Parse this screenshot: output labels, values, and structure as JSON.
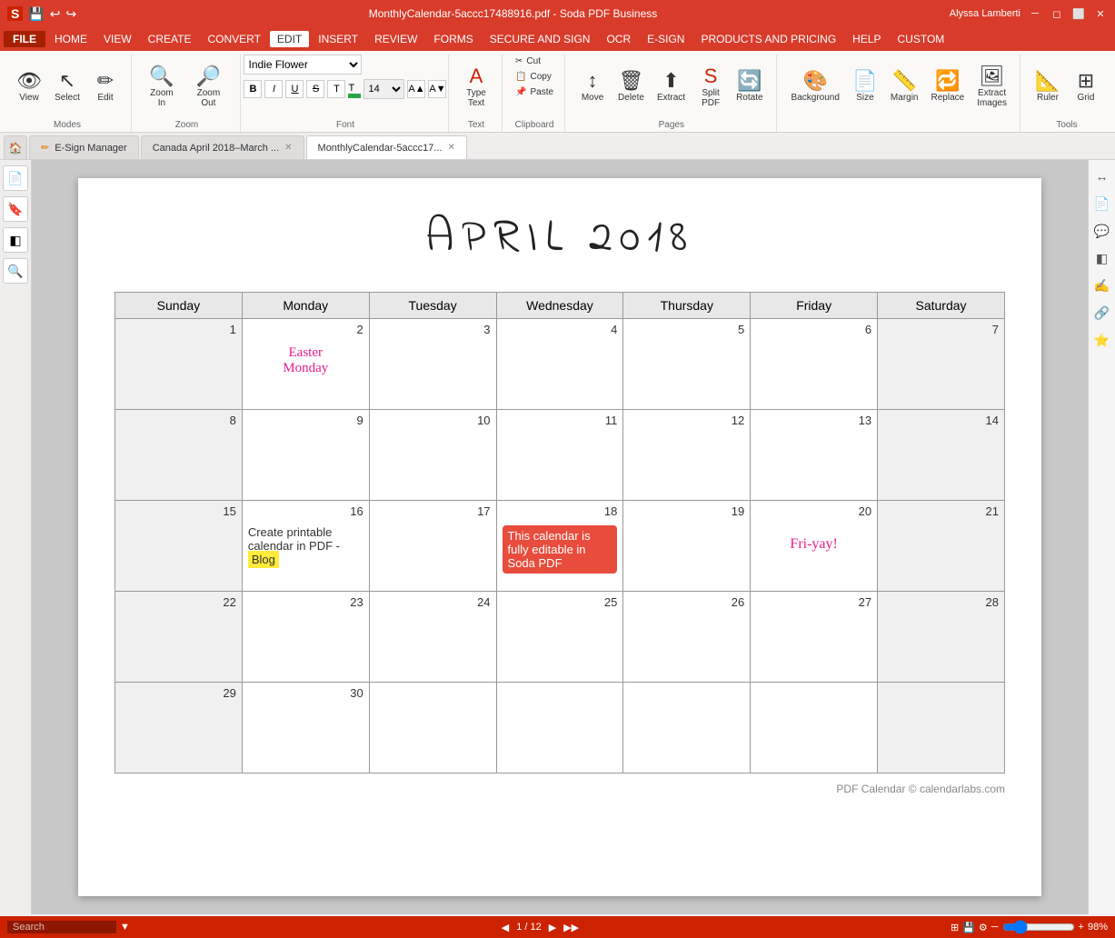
{
  "titlebar": {
    "document_name": "MonthlyCalendar-5accc17488916.pdf",
    "app_name": "Soda PDF Business",
    "full_title": "MonthlyCalendar-5accc17488916.pdf  -  Soda PDF Business"
  },
  "menubar": {
    "items": [
      "FILE",
      "HOME",
      "VIEW",
      "CREATE",
      "CONVERT",
      "EDIT",
      "INSERT",
      "REVIEW",
      "FORMS",
      "SECURE AND SIGN",
      "OCR",
      "E-SIGN",
      "PRODUCTS AND PRICING",
      "HELP",
      "CUSTOM"
    ],
    "active": "EDIT"
  },
  "ribbon": {
    "modes_group": {
      "label": "Modes",
      "view_label": "View",
      "select_label": "Select",
      "edit_label": "Edit"
    },
    "zoom_group": {
      "label": "Zoom",
      "zoom_in_label": "Zoom In",
      "zoom_out_label": "Zoom Out"
    },
    "font_group": {
      "label": "Font",
      "font_name": "Indie Flower",
      "font_size": "14",
      "bold": "B",
      "italic": "I",
      "underline": "U",
      "strikethrough": "S",
      "superscript": "T",
      "subscript": "T"
    },
    "text_group": {
      "label": "Text",
      "type_text_label": "Type\nText"
    },
    "clipboard_group": {
      "label": "Clipboard",
      "cut_label": "Cut",
      "copy_label": "Copy",
      "paste_label": "Paste"
    },
    "pages_group": {
      "label": "Pages",
      "move_label": "Move",
      "delete_label": "Delete",
      "extract_label": "Extract",
      "split_pdf_label": "Split\nPDF",
      "rotate_label": "Rotate"
    },
    "bg_group": {
      "label": "",
      "background_label": "Background",
      "size_label": "Size",
      "margin_label": "Margin",
      "replace_label": "Replace",
      "extract_images_label": "Extract\nImages"
    },
    "tools_group": {
      "label": "Tools",
      "ruler_label": "Ruler",
      "grid_label": "Grid"
    }
  },
  "tabs": {
    "items": [
      {
        "id": "esign",
        "label": "E-Sign Manager",
        "closable": false,
        "active": false
      },
      {
        "id": "canada",
        "label": "Canada April 2018–March ...",
        "closable": true,
        "active": false
      },
      {
        "id": "monthly",
        "label": "MonthlyCalendar-5accc17...",
        "closable": true,
        "active": true
      }
    ]
  },
  "calendar": {
    "title": "APRIL  2018",
    "headers": [
      "Sunday",
      "Monday",
      "Tuesday",
      "Wednesday",
      "Thursday",
      "Friday",
      "Saturday"
    ],
    "footer": "PDF Calendar © calendarlabs.com",
    "weeks": [
      [
        {
          "day": 1,
          "weekend": true,
          "note": ""
        },
        {
          "day": 2,
          "weekend": false,
          "note": "Easter Monday",
          "note_style": "easter"
        },
        {
          "day": 3,
          "weekend": false,
          "note": ""
        },
        {
          "day": 4,
          "weekend": false,
          "note": ""
        },
        {
          "day": 5,
          "weekend": false,
          "note": ""
        },
        {
          "day": 6,
          "weekend": false,
          "note": ""
        },
        {
          "day": 7,
          "weekend": true,
          "note": ""
        }
      ],
      [
        {
          "day": 8,
          "weekend": true,
          "note": ""
        },
        {
          "day": 9,
          "weekend": false,
          "note": ""
        },
        {
          "day": 10,
          "weekend": false,
          "note": ""
        },
        {
          "day": 11,
          "weekend": false,
          "note": ""
        },
        {
          "day": 12,
          "weekend": false,
          "note": ""
        },
        {
          "day": 13,
          "weekend": false,
          "note": ""
        },
        {
          "day": 14,
          "weekend": true,
          "note": ""
        }
      ],
      [
        {
          "day": 15,
          "weekend": true,
          "note": ""
        },
        {
          "day": 16,
          "weekend": false,
          "note": "Create printable calendar in PDF - Blog",
          "note_style": "blog"
        },
        {
          "day": 17,
          "weekend": false,
          "note": ""
        },
        {
          "day": 18,
          "weekend": false,
          "note": "This calendar is fully editable in Soda PDF",
          "note_style": "red"
        },
        {
          "day": 19,
          "weekend": false,
          "note": ""
        },
        {
          "day": 20,
          "weekend": false,
          "note": "Fri-yay!",
          "note_style": "fryay"
        },
        {
          "day": 21,
          "weekend": true,
          "note": ""
        }
      ],
      [
        {
          "day": 22,
          "weekend": true,
          "note": ""
        },
        {
          "day": 23,
          "weekend": false,
          "note": ""
        },
        {
          "day": 24,
          "weekend": false,
          "note": ""
        },
        {
          "day": 25,
          "weekend": false,
          "note": ""
        },
        {
          "day": 26,
          "weekend": false,
          "note": ""
        },
        {
          "day": 27,
          "weekend": false,
          "note": ""
        },
        {
          "day": 28,
          "weekend": true,
          "note": ""
        }
      ],
      [
        {
          "day": 29,
          "weekend": true,
          "note": ""
        },
        {
          "day": 30,
          "weekend": false,
          "note": ""
        },
        {
          "day": "",
          "weekend": false,
          "note": ""
        },
        {
          "day": "",
          "weekend": false,
          "note": ""
        },
        {
          "day": "",
          "weekend": false,
          "note": ""
        },
        {
          "day": "",
          "weekend": false,
          "note": ""
        },
        {
          "day": "",
          "weekend": true,
          "note": ""
        }
      ]
    ]
  },
  "statusbar": {
    "search_placeholder": "Search",
    "page_info": "1 / 12",
    "zoom_level": "98%"
  },
  "user": {
    "name": "Alyssa Lamberti"
  }
}
